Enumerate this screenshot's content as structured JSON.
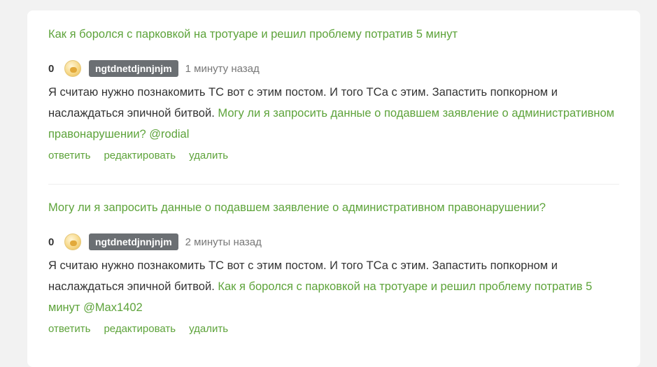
{
  "comments": [
    {
      "post_title": "Как я боролся с парковкой на тротуаре и решил проблему потратив 5 минут",
      "score": "0",
      "author": "ngtdnetdjnnjnjm",
      "time": "1 минуту назад",
      "text": "Я считаю нужно познакомить ТС вот с этим постом. И того ТСа с этим. Запастить попкорном и наслаждаться эпичной битвой.",
      "link_text": "Могу ли я запросить данные о подавшем заявление о административном правонарушении? @rodial",
      "actions": {
        "reply": "ответить",
        "edit": "редактировать",
        "delete": "удалить"
      }
    },
    {
      "post_title": "Могу ли я запросить данные о подавшем заявление о административном правонарушении?",
      "score": "0",
      "author": "ngtdnetdjnnjnjm",
      "time": "2 минуты назад",
      "text": "Я считаю нужно познакомить ТС вот с этим постом. И того ТСа с этим. Запастить попкорном и наслаждаться эпичной битвой.",
      "link_text": "Как я боролся с парковкой на тротуаре и решил проблему потратив 5 минут @Max1402",
      "actions": {
        "reply": "ответить",
        "edit": "редактировать",
        "delete": "удалить"
      }
    }
  ],
  "colors": {
    "accent": "#5da33a",
    "badge_bg": "#6b6f73",
    "text": "#333333",
    "muted": "#777777"
  },
  "icons": {
    "avatar": "user-avatar-icon"
  }
}
